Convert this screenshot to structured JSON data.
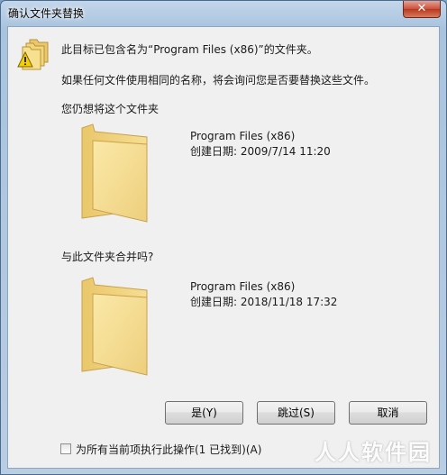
{
  "window": {
    "title": "确认文件夹替换",
    "close_symbol": "✕"
  },
  "message": {
    "line1": "此目标已包含名为“Program Files (x86)”的文件夹。",
    "line2": "如果任何文件使用相同的名称，将会询问您是否要替换这些文件。",
    "line3": "您仍想将这个文件夹"
  },
  "source_folder": {
    "name": "Program Files (x86)",
    "created": "创建日期: 2009/7/14 11:20"
  },
  "merge_question": "与此文件夹合并吗?",
  "dest_folder": {
    "name": "Program Files (x86)",
    "created": "创建日期: 2018/11/18 17:32"
  },
  "buttons": {
    "yes": "是(Y)",
    "skip": "跳过(S)",
    "cancel": "取消"
  },
  "apply_all": {
    "label": "为所有当前项执行此操作(1 已找到)(A)",
    "checked": false
  },
  "watermark": "人人软件园",
  "icons": {
    "warning": "warning-folders-icon",
    "folder": "folder-icon"
  }
}
